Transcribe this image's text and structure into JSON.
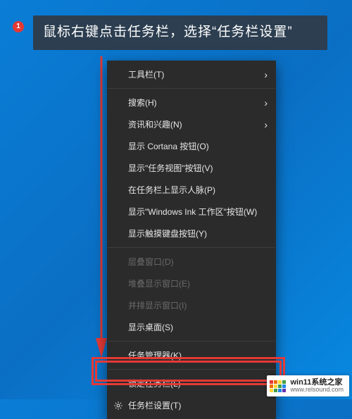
{
  "callout": {
    "badge": "1",
    "text": "鼠标右键点击任务栏，选择“任务栏设置”"
  },
  "menu": {
    "toolbars": "工具栏(T)",
    "search": "搜索(H)",
    "news": "资讯和兴趣(N)",
    "cortana": "显示 Cortana 按钮(O)",
    "taskview": "显示\"任务视图\"按钮(V)",
    "people": "在任务栏上显示人脉(P)",
    "ink": "显示\"Windows Ink 工作区\"按钮(W)",
    "touchkb": "显示触摸键盘按钮(Y)",
    "cascade": "层叠窗口(D)",
    "stackh": "堆叠显示窗口(E)",
    "stackv": "并排显示窗口(I)",
    "desktop": "显示桌面(S)",
    "taskmgr": "任务管理器(K)",
    "lock": "锁定任务栏(L)",
    "settings": "任务栏设置(T)"
  },
  "watermark": {
    "line1": "win11系统之家",
    "line2": "www.relsound.com"
  },
  "colors": {
    "badge_red": "#e53935",
    "menu_bg": "#2b2b2b",
    "menu_fg": "#e6e6e6",
    "menu_disabled": "#6a6a6a"
  }
}
